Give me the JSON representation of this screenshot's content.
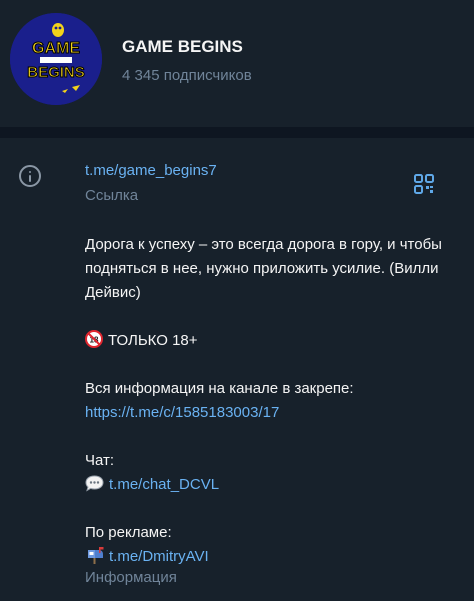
{
  "channel": {
    "title": "GAME BEGINS",
    "subscribers": "4 345 подписчиков",
    "avatar_text": [
      "GAME",
      "BEGINS"
    ]
  },
  "info": {
    "link": "t.me/game_begins7",
    "link_label": "Ссылка",
    "description_label": "Информация",
    "quote": "Дорога к успеху – это всегда дорога в гору, и чтобы подняться в нее, нужно приложить усилие. (Вилли Дейвис)",
    "age_warning": "ТОЛЬКО 18+",
    "pinned_info": "Вся информация на канале в закрепе:",
    "pinned_link": "https://t.me/c/1585183003/17",
    "chat_label": "Чат:",
    "chat_link": "t.me/chat_DCVL",
    "ads_label": "По рекламе:",
    "ads_link": "t.me/DmitryAVI"
  },
  "icons": {
    "info": "info-circle-icon",
    "qr": "qr-code-icon",
    "age": "no-under-18-emoji",
    "chat": "speech-balloon-emoji",
    "ads": "mailbox-emoji"
  },
  "colors": {
    "background": "#17212b",
    "divider": "#0e1621",
    "link": "#6ab2f2",
    "secondary_text": "#708499",
    "primary_text": "#f5f5f5"
  }
}
